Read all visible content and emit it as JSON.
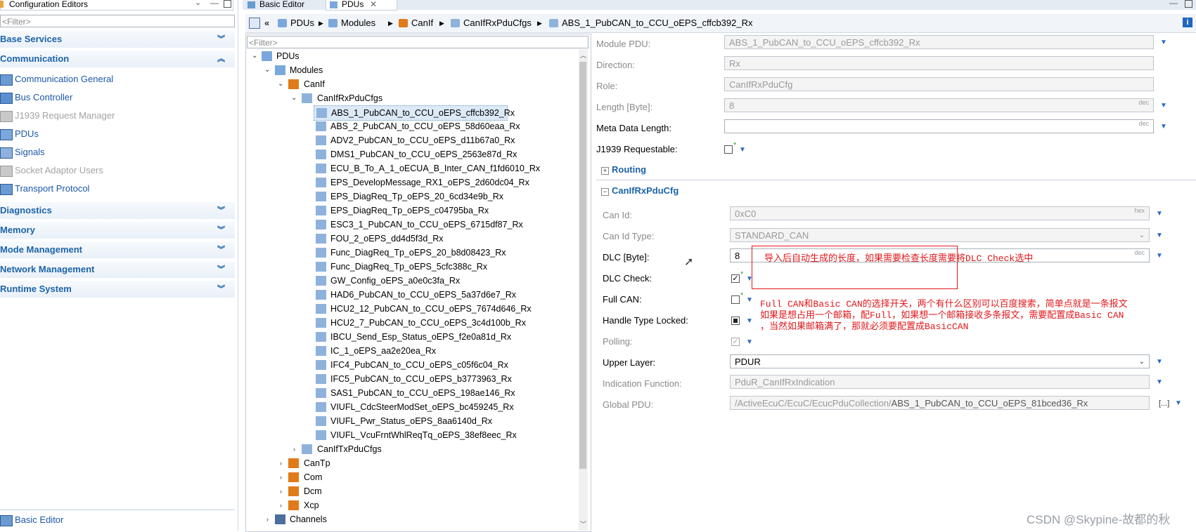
{
  "left_panel": {
    "title": "Configuration Editors",
    "filter_placeholder": "<Filter>",
    "categories": [
      {
        "label": "Base Services",
        "expanded": false
      },
      {
        "label": "Communication",
        "expanded": true
      },
      {
        "label": "Diagnostics",
        "expanded": false
      },
      {
        "label": "Memory",
        "expanded": false
      },
      {
        "label": "Mode Management",
        "expanded": false
      },
      {
        "label": "Network Management",
        "expanded": false
      },
      {
        "label": "Runtime System",
        "expanded": false
      }
    ],
    "communication_items": [
      {
        "label": "Communication General",
        "enabled": true
      },
      {
        "label": "Bus Controller",
        "enabled": true
      },
      {
        "label": "J1939 Request Manager",
        "enabled": false
      },
      {
        "label": "PDUs",
        "enabled": true
      },
      {
        "label": "Signals",
        "enabled": true
      },
      {
        "label": "Socket Adaptor Users",
        "enabled": false
      },
      {
        "label": "Transport Protocol",
        "enabled": true
      }
    ],
    "bottom_link": "Basic Editor"
  },
  "tabs": [
    {
      "label": "Basic Editor",
      "active": false
    },
    {
      "label": "PDUs",
      "active": true
    }
  ],
  "breadcrumb": [
    "PDUs",
    "Modules",
    "CanIf",
    "CanIfRxPduCfgs",
    "ABS_1_PubCAN_to_CCU_oEPS_cffcb392_Rx"
  ],
  "tree": {
    "filter_placeholder": "<Filter>",
    "root": "PDUs",
    "modules": "Modules",
    "canif": "CanIf",
    "rxcfgs": "CanIfRxPduCfgs",
    "rx_items": [
      "ABS_1_PubCAN_to_CCU_oEPS_cffcb392_Rx",
      "ABS_2_PubCAN_to_CCU_oEPS_58d60eaa_Rx",
      "ADV2_PubCAN_to_CCU_oEPS_d11b67a0_Rx",
      "DMS1_PubCAN_to_CCU_oEPS_2563e87d_Rx",
      "ECU_B_To_A_1_oECUA_B_Inter_CAN_f1fd6010_Rx",
      "EPS_DevelopMessage_RX1_oEPS_2d60dc04_Rx",
      "EPS_DiagReq_Tp_oEPS_20_6cd34e9b_Rx",
      "EPS_DiagReq_Tp_oEPS_c04795ba_Rx",
      "ESC3_1_PubCAN_to_CCU_oEPS_6715df87_Rx",
      "FOU_2_oEPS_dd4d5f3d_Rx",
      "Func_DiagReq_Tp_oEPS_20_b8d08423_Rx",
      "Func_DiagReq_Tp_oEPS_5cfc388c_Rx",
      "GW_Config_oEPS_a0e0c3fa_Rx",
      "HAD6_PubCAN_to_CCU_oEPS_5a37d6e7_Rx",
      "HCU2_12_PubCAN_to_CCU_oEPS_7674d646_Rx",
      "HCU2_7_PubCAN_to_CCU_oEPS_3c4d100b_Rx",
      "IBCU_Send_Esp_Status_oEPS_f2e0a81d_Rx",
      "IC_1_oEPS_aa2e20ea_Rx",
      "IFC4_PubCAN_to_CCU_oEPS_c05f6c04_Rx",
      "IFC5_PubCAN_to_CCU_oEPS_b3773963_Rx",
      "SAS1_PubCAN_to_CCU_oEPS_198ae146_Rx",
      "VIUFL_CdcSteerModSet_oEPS_bc459245_Rx",
      "VIUFL_Pwr_Status_oEPS_8aa6140d_Rx",
      "VIUFL_VcuFrntWhlReqTq_oEPS_38ef8eec_Rx"
    ],
    "txcfgs": "CanIfTxPduCfgs",
    "other_modules": [
      "CanTp",
      "Com",
      "Dcm",
      "Xcp"
    ],
    "channels": "Channels"
  },
  "properties": {
    "module_pdu": {
      "label": "Module PDU:",
      "value": "ABS_1_PubCAN_to_CCU_oEPS_cffcb392_Rx"
    },
    "direction": {
      "label": "Direction:",
      "value": "Rx"
    },
    "role": {
      "label": "Role:",
      "value": "CanIfRxPduCfg"
    },
    "length": {
      "label": "Length [Byte]:",
      "value": "8",
      "unit": "dec"
    },
    "meta_data_length": {
      "label": "Meta Data Length:",
      "value": "",
      "unit": "dec"
    },
    "j1939_requestable": {
      "label": "J1939 Requestable:",
      "checked": false
    },
    "routing_section": "Routing",
    "canif_section": "CanIfRxPduCfg",
    "can_id": {
      "label": "Can Id:",
      "value": "0xC0",
      "unit": "hex"
    },
    "can_id_type": {
      "label": "Can Id Type:",
      "value": "STANDARD_CAN"
    },
    "dlc": {
      "label": "DLC [Byte]:",
      "value": "8",
      "unit": "dec"
    },
    "dlc_check": {
      "label": "DLC Check:",
      "checked": true
    },
    "full_can": {
      "label": "Full CAN:",
      "checked": false
    },
    "handle_type_locked": {
      "label": "Handle Type Locked:"
    },
    "polling": {
      "label": "Polling:",
      "checked": true
    },
    "upper_layer": {
      "label": "Upper Layer:",
      "value": "PDUR"
    },
    "indication_function": {
      "label": "Indication Function:",
      "value": "PduR_CanIfRxIndication"
    },
    "global_pdu": {
      "label": "Global PDU:",
      "value_prefix": "/ActiveEcuC/EcuC/EcucPduCollection/",
      "value": "ABS_1_PubCAN_to_CCU_oEPS_81bced36_Rx",
      "browse": "[...]"
    }
  },
  "annotations": {
    "dlc_note": "导入后自动生成的长度，如果需要检查长度需要将DLC Check选中",
    "fullcan_note_1": "Full CAN和Basic CAN的选择开关，两个有什么区别可以百度搜索，简单点就是一条报文",
    "fullcan_note_2": "如果是想占用一个邮箱，配Full，如果想一个邮箱接收多条报文，需要配置成Basic CAN",
    "fullcan_note_3": "，当然如果邮箱满了，那就必须要配置成BasicCAN"
  },
  "watermark": "CSDN @Skypine-故都的秋",
  "colors": {
    "accent": "#1c63a8",
    "annotation": "#e0181b",
    "link": "#1c57a8"
  }
}
